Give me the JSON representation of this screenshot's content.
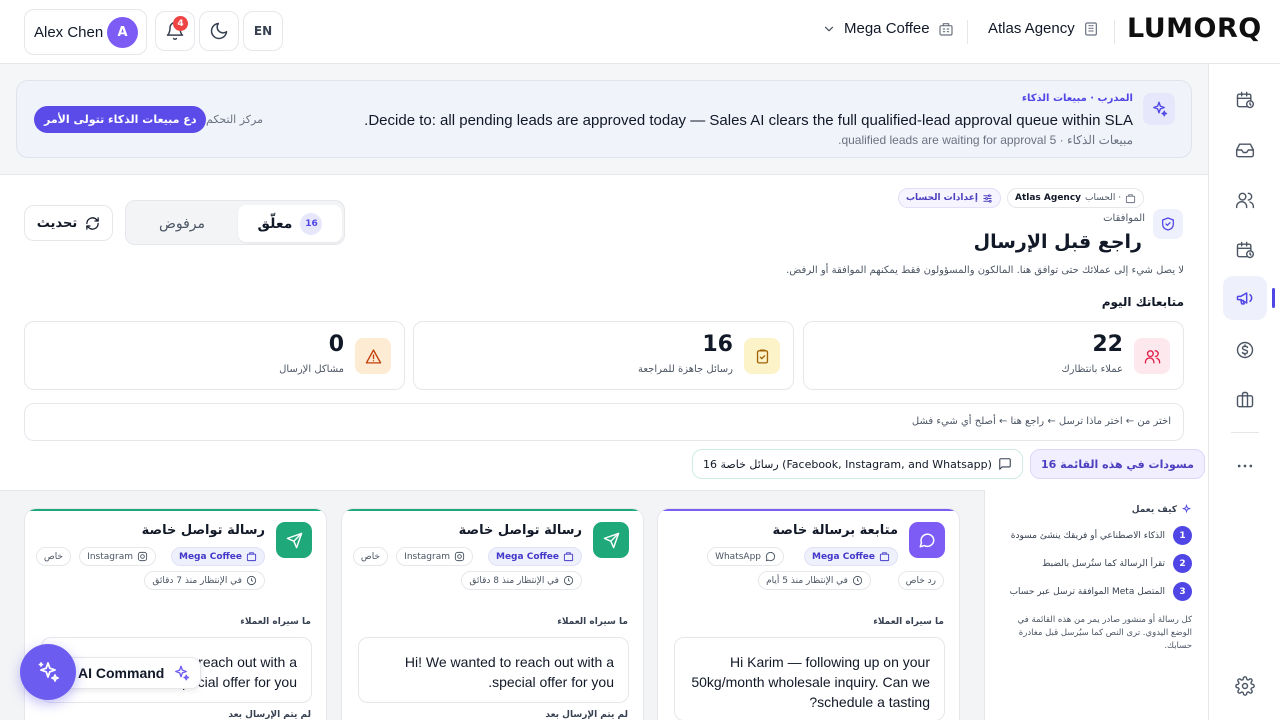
{
  "topbar": {
    "user_name": "Alex Chen",
    "avatar_initial": "A",
    "notification_count": "4",
    "language": "EN",
    "workspace": "Mega Coffee",
    "agency": "Atlas Agency",
    "logo": "LUMORQ"
  },
  "banner": {
    "kicker": "المدرب · مبيعات الذكاء",
    "title": "Decide to: all pending leads are approved today — Sales AI clears the full qualified-lead approval queue within SLA.",
    "subtitle": "مبيعات الذكاء · 5 qualified leads are waiting for approval.",
    "cta": "دع مبيعات الذكاء تتولى الأمر",
    "link": "مركز التحكم"
  },
  "header": {
    "account_label": "الحساب ·",
    "account_value": "Atlas Agency",
    "settings_pill": "إعدادات الحساب",
    "crumb": "الموافقات",
    "title": "راجع قبل الإرسال",
    "description": "لا يصل شيء إلى عملائك حتى توافق هنا. المالكون والمسؤولون فقط يمكنهم الموافقة أو الرفض."
  },
  "tabs": {
    "pending_label": "معلّق",
    "pending_count": "16",
    "rejected_label": "مرفوض"
  },
  "refresh_label": "تحديث",
  "today_title": "متابعاتك اليوم",
  "stats": [
    {
      "value": "22",
      "label": "عملاء بانتظارك"
    },
    {
      "value": "16",
      "label": "رسائل جاهزة للمراجعة"
    },
    {
      "value": "0",
      "label": "مشاكل الإرسال"
    }
  ],
  "flow_text": "اختر من ← اختر ماذا ترسل ← راجع هنا ← أصلح أي شيء فشل",
  "chips": {
    "drafts": "16 مسودات في هذه القائمة",
    "private": "16 رسائل خاصة (Facebook, Instagram, and Whatsapp)"
  },
  "cards": [
    {
      "title": "متابعة برسالة خاصة",
      "brand": "Mega Coffee",
      "channel": "WhatsApp",
      "tag": "رد خاص",
      "waiting": "في الإنتظار منذ 5 أيام",
      "sub": "ما سيراه العملاء",
      "message": "Hi Karim — following up on your 50kg/month wholesale inquiry. Can we schedule a tasting?",
      "footer": ""
    },
    {
      "title": "رسالة تواصل خاصة",
      "brand": "Mega Coffee",
      "channel": "Instagram",
      "tag": "خاص",
      "waiting": "في الإنتظار منذ 8 دقائق",
      "sub": "ما سيراه العملاء",
      "message": "Hi! We wanted to reach out with a special offer for you.",
      "footer": "لم يتم الإرسال بعد"
    },
    {
      "title": "رسالة تواصل خاصة",
      "brand": "Mega Coffee",
      "channel": "Instagram",
      "tag": "خاص",
      "waiting": "في الإنتظار منذ 7 دقائق",
      "sub": "ما سيراه العملاء",
      "message": "Hi! We wanted to reach out with a special offer for you.",
      "footer": "لم يتم الإرسال بعد"
    }
  ],
  "how": {
    "title": "كيف يعمل",
    "steps": [
      "الذكاء الاصطناعي أو فريقك ينشئ مسودة",
      "تقرأ الرسالة كما ستُرسل بالضبط",
      "الموافقة ترسل عبر حساب Meta المتصل"
    ],
    "note": "كل رسالة أو منشور صادر يمر من هذه القائمة في الوضع اليدوي. ترى النص كما سيُرسل قبل مغادرة حسابك."
  },
  "ai_command": "AI Command",
  "colors": {
    "accent": "#4f46e5",
    "green": "#1fa97a",
    "purple_icon": "#7c5cf5"
  }
}
